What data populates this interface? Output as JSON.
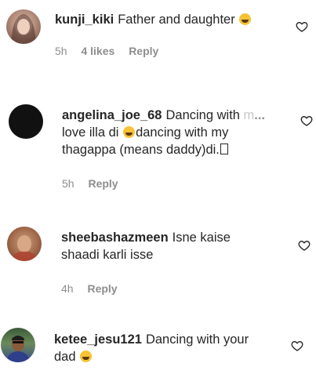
{
  "comments": [
    {
      "username": "kunji_kiki",
      "text": "Father and daughter",
      "time": "5h",
      "likes": "4 likes",
      "reply": "Reply"
    },
    {
      "username": "angelina_joe_68",
      "text_line1_start": "Dancing with",
      "text_line1_faded": "m",
      "more": "...",
      "text_line2a": "love illa di",
      "text_line2b": "dancing with my",
      "text_line3": "thagappa (means daddy)di.",
      "time": "5h",
      "reply": "Reply"
    },
    {
      "username": "sheebashazmeen",
      "text_line1": "Isne kaise",
      "text_line2": "shaadi karli isse",
      "time": "4h",
      "reply": "Reply"
    },
    {
      "username": "ketee_jesu121",
      "text_line1": "Dancing with your",
      "text_line2": "dad",
      "time": "",
      "reply": ""
    }
  ],
  "icons": {
    "like": "heart-outline-icon",
    "laugh": "grinning-emoji",
    "tongue": "tongue-out-emoji"
  },
  "colors": {
    "text": "#262626",
    "meta": "#8e8e8e"
  }
}
